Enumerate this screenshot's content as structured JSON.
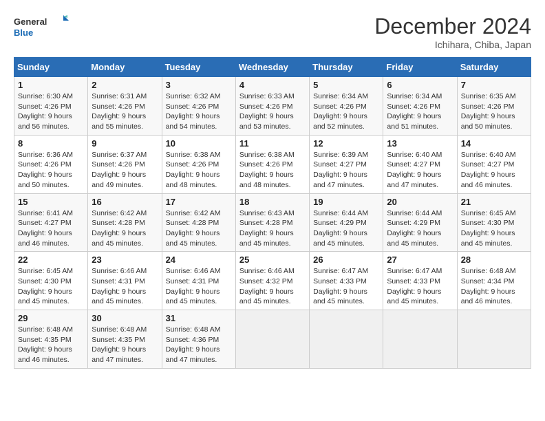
{
  "header": {
    "logo_line1": "General",
    "logo_line2": "Blue",
    "title": "December 2024",
    "subtitle": "Ichihara, Chiba, Japan"
  },
  "calendar": {
    "days_of_week": [
      "Sunday",
      "Monday",
      "Tuesday",
      "Wednesday",
      "Thursday",
      "Friday",
      "Saturday"
    ],
    "weeks": [
      [
        {
          "day": "1",
          "info": "Sunrise: 6:30 AM\nSunset: 4:26 PM\nDaylight: 9 hours\nand 56 minutes."
        },
        {
          "day": "2",
          "info": "Sunrise: 6:31 AM\nSunset: 4:26 PM\nDaylight: 9 hours\nand 55 minutes."
        },
        {
          "day": "3",
          "info": "Sunrise: 6:32 AM\nSunset: 4:26 PM\nDaylight: 9 hours\nand 54 minutes."
        },
        {
          "day": "4",
          "info": "Sunrise: 6:33 AM\nSunset: 4:26 PM\nDaylight: 9 hours\nand 53 minutes."
        },
        {
          "day": "5",
          "info": "Sunrise: 6:34 AM\nSunset: 4:26 PM\nDaylight: 9 hours\nand 52 minutes."
        },
        {
          "day": "6",
          "info": "Sunrise: 6:34 AM\nSunset: 4:26 PM\nDaylight: 9 hours\nand 51 minutes."
        },
        {
          "day": "7",
          "info": "Sunrise: 6:35 AM\nSunset: 4:26 PM\nDaylight: 9 hours\nand 50 minutes."
        }
      ],
      [
        {
          "day": "8",
          "info": "Sunrise: 6:36 AM\nSunset: 4:26 PM\nDaylight: 9 hours\nand 50 minutes."
        },
        {
          "day": "9",
          "info": "Sunrise: 6:37 AM\nSunset: 4:26 PM\nDaylight: 9 hours\nand 49 minutes."
        },
        {
          "day": "10",
          "info": "Sunrise: 6:38 AM\nSunset: 4:26 PM\nDaylight: 9 hours\nand 48 minutes."
        },
        {
          "day": "11",
          "info": "Sunrise: 6:38 AM\nSunset: 4:26 PM\nDaylight: 9 hours\nand 48 minutes."
        },
        {
          "day": "12",
          "info": "Sunrise: 6:39 AM\nSunset: 4:27 PM\nDaylight: 9 hours\nand 47 minutes."
        },
        {
          "day": "13",
          "info": "Sunrise: 6:40 AM\nSunset: 4:27 PM\nDaylight: 9 hours\nand 47 minutes."
        },
        {
          "day": "14",
          "info": "Sunrise: 6:40 AM\nSunset: 4:27 PM\nDaylight: 9 hours\nand 46 minutes."
        }
      ],
      [
        {
          "day": "15",
          "info": "Sunrise: 6:41 AM\nSunset: 4:27 PM\nDaylight: 9 hours\nand 46 minutes."
        },
        {
          "day": "16",
          "info": "Sunrise: 6:42 AM\nSunset: 4:28 PM\nDaylight: 9 hours\nand 45 minutes."
        },
        {
          "day": "17",
          "info": "Sunrise: 6:42 AM\nSunset: 4:28 PM\nDaylight: 9 hours\nand 45 minutes."
        },
        {
          "day": "18",
          "info": "Sunrise: 6:43 AM\nSunset: 4:28 PM\nDaylight: 9 hours\nand 45 minutes."
        },
        {
          "day": "19",
          "info": "Sunrise: 6:44 AM\nSunset: 4:29 PM\nDaylight: 9 hours\nand 45 minutes."
        },
        {
          "day": "20",
          "info": "Sunrise: 6:44 AM\nSunset: 4:29 PM\nDaylight: 9 hours\nand 45 minutes."
        },
        {
          "day": "21",
          "info": "Sunrise: 6:45 AM\nSunset: 4:30 PM\nDaylight: 9 hours\nand 45 minutes."
        }
      ],
      [
        {
          "day": "22",
          "info": "Sunrise: 6:45 AM\nSunset: 4:30 PM\nDaylight: 9 hours\nand 45 minutes."
        },
        {
          "day": "23",
          "info": "Sunrise: 6:46 AM\nSunset: 4:31 PM\nDaylight: 9 hours\nand 45 minutes."
        },
        {
          "day": "24",
          "info": "Sunrise: 6:46 AM\nSunset: 4:31 PM\nDaylight: 9 hours\nand 45 minutes."
        },
        {
          "day": "25",
          "info": "Sunrise: 6:46 AM\nSunset: 4:32 PM\nDaylight: 9 hours\nand 45 minutes."
        },
        {
          "day": "26",
          "info": "Sunrise: 6:47 AM\nSunset: 4:33 PM\nDaylight: 9 hours\nand 45 minutes."
        },
        {
          "day": "27",
          "info": "Sunrise: 6:47 AM\nSunset: 4:33 PM\nDaylight: 9 hours\nand 45 minutes."
        },
        {
          "day": "28",
          "info": "Sunrise: 6:48 AM\nSunset: 4:34 PM\nDaylight: 9 hours\nand 46 minutes."
        }
      ],
      [
        {
          "day": "29",
          "info": "Sunrise: 6:48 AM\nSunset: 4:35 PM\nDaylight: 9 hours\nand 46 minutes."
        },
        {
          "day": "30",
          "info": "Sunrise: 6:48 AM\nSunset: 4:35 PM\nDaylight: 9 hours\nand 47 minutes."
        },
        {
          "day": "31",
          "info": "Sunrise: 6:48 AM\nSunset: 4:36 PM\nDaylight: 9 hours\nand 47 minutes."
        },
        {
          "day": "",
          "info": ""
        },
        {
          "day": "",
          "info": ""
        },
        {
          "day": "",
          "info": ""
        },
        {
          "day": "",
          "info": ""
        }
      ]
    ]
  }
}
